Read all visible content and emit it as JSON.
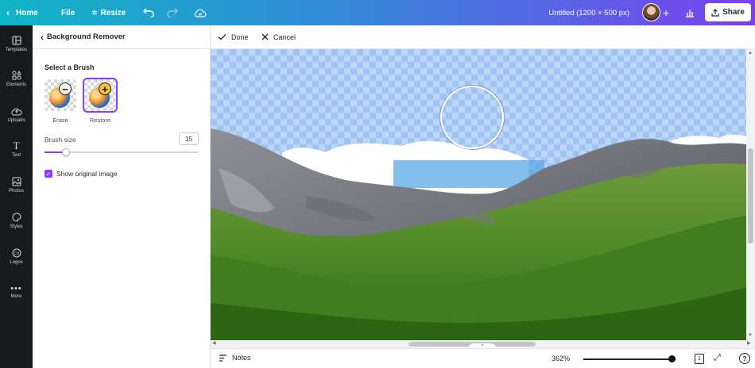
{
  "topbar": {
    "home_label": "Home",
    "file_label": "File",
    "resize_label": "Resize",
    "doc_title": "Untitled (1200 × 500 px)",
    "share_label": "Share",
    "gradient": [
      "#10b5c6",
      "#7b3ff0"
    ]
  },
  "rail": {
    "items": [
      {
        "label": "Templates",
        "icon": "templates-icon"
      },
      {
        "label": "Elements",
        "icon": "elements-icon"
      },
      {
        "label": "Uploads",
        "icon": "uploads-icon"
      },
      {
        "label": "Text",
        "icon": "text-icon"
      },
      {
        "label": "Photos",
        "icon": "photos-icon"
      },
      {
        "label": "Styles",
        "icon": "styles-icon"
      },
      {
        "label": "Logos",
        "icon": "logos-icon"
      },
      {
        "label": "More",
        "icon": "more-icon"
      }
    ]
  },
  "panel": {
    "title": "Background Remover",
    "select_title": "Select a Brush",
    "erase_label": "Erase",
    "restore_label": "Restore",
    "selected_brush": "Restore",
    "brush_size_label": "Brush size",
    "brush_size_value": "15",
    "brush_size_fraction": 0.14,
    "show_original_label": "Show original image",
    "show_original_checked": true,
    "accent": "#8b3dff"
  },
  "editbar": {
    "done_label": "Done",
    "cancel_label": "Cancel"
  },
  "footer": {
    "notes_label": "Notes",
    "zoom_label": "362%",
    "zoom_fraction": 0.96,
    "page_label": "1",
    "help_label": "?"
  }
}
